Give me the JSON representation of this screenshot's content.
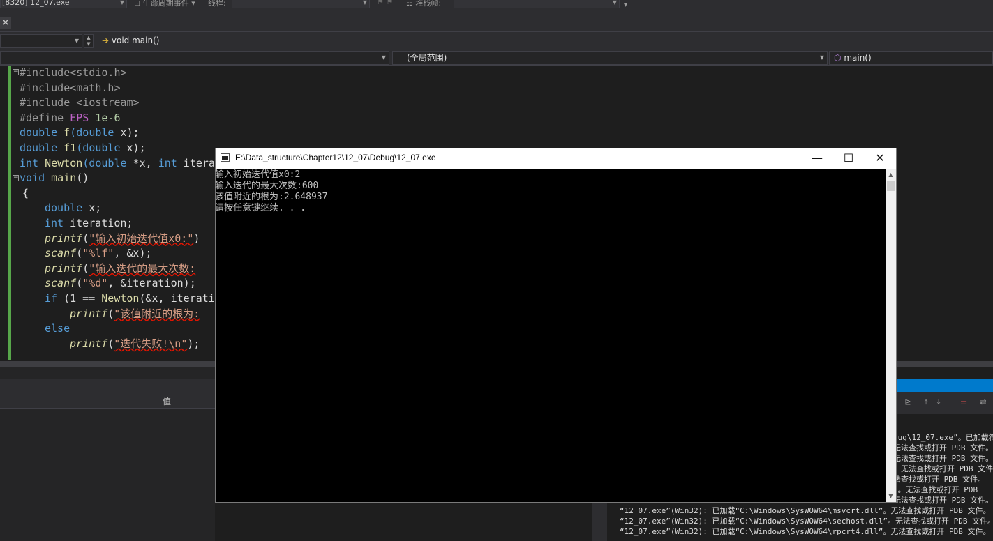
{
  "toolbar": {
    "process": "[8320] 12_07.exe",
    "lifecycle_label": "生命周期事件",
    "thread_label": "线程:",
    "stack_label": "堆栈帧:"
  },
  "nav": {
    "function_box": "void main()",
    "scope_box": "(全局范围)",
    "member_box": "main()"
  },
  "code": {
    "l1": "#include<stdio.h>",
    "l2": "#include<math.h>",
    "l3": "#include <iostream>",
    "l4a": "#define ",
    "l4b": "EPS",
    "l4c": " 1e-6",
    "l5a": "double",
    "l5b": " f",
    "l5c": "(double",
    "l5d": " x);",
    "l6a": "double",
    "l6b": " f1",
    "l6c": "(double",
    "l6d": " x);",
    "l7a": "int",
    "l7b": " Newton",
    "l7c": "(double",
    "l7d": " *x, ",
    "l7e": "int",
    "l7f": " itera",
    "l8a": "void",
    "l8b": " main",
    "l8c": "()",
    "l9": "{",
    "l10a": "double",
    "l10b": " x;",
    "l11a": "int",
    "l11b": " iteration;",
    "l12a": "printf",
    "l12b": "(",
    "l12c": "\"输入初始迭代值x0:\"",
    "l12d": ")",
    "l13a": "scanf",
    "l13b": "(",
    "l13c": "\"%lf\"",
    "l13d": ", &x);",
    "l14a": "printf",
    "l14b": "(",
    "l14c": "\"输入迭代的最大次数:",
    "l15a": "scanf",
    "l15b": "(",
    "l15c": "\"%d\"",
    "l15d": ", &iteration);",
    "l16a": "if",
    "l16b": " (1 == ",
    "l16c": "Newton",
    "l16d": "(&x, iterati",
    "l17a": "printf",
    "l17b": "(",
    "l17c": "\"该值附近的根为:",
    "l18": "else",
    "l19a": "printf",
    "l19b": "(",
    "l19c": "\"迭代失败!\\n\"",
    "l19d": ");"
  },
  "locals": {
    "value_header": "值"
  },
  "console": {
    "title": "E:\\Data_structure\\Chapter12\\12_07\\Debug\\12_07.exe",
    "lines": [
      "输入初始迭代值x0:2",
      "输入迭代的最大次数:600",
      "该值附近的根为:2.648937",
      "请按任意键继续. . ."
    ]
  },
  "output": {
    "right_lines": [
      "bug\\12_07.exe”。已加载符",
      "无法查找或打开 PDB 文件。",
      "无法查找或打开 PDB 文件。",
      "。无法查找或打开 PDB 文件",
      "法查找或打开 PDB 文件。",
      "”。无法查找或打开 PDB",
      "无法查找或打开 PDB 文件。"
    ],
    "bottom_lines": [
      "“12_07.exe”(Win32): 已加载“C:\\Windows\\SysWOW64\\msvcrt.dll”。无法查找或打开 PDB 文件。",
      "“12_07.exe”(Win32): 已加载“C:\\Windows\\SysWOW64\\sechost.dll”。无法查找或打开 PDB 文件。",
      "“12_07.exe”(Win32): 已加载“C:\\Windows\\SysWOW64\\rpcrt4.dll”。无法查找或打开 PDB 文件。"
    ]
  }
}
